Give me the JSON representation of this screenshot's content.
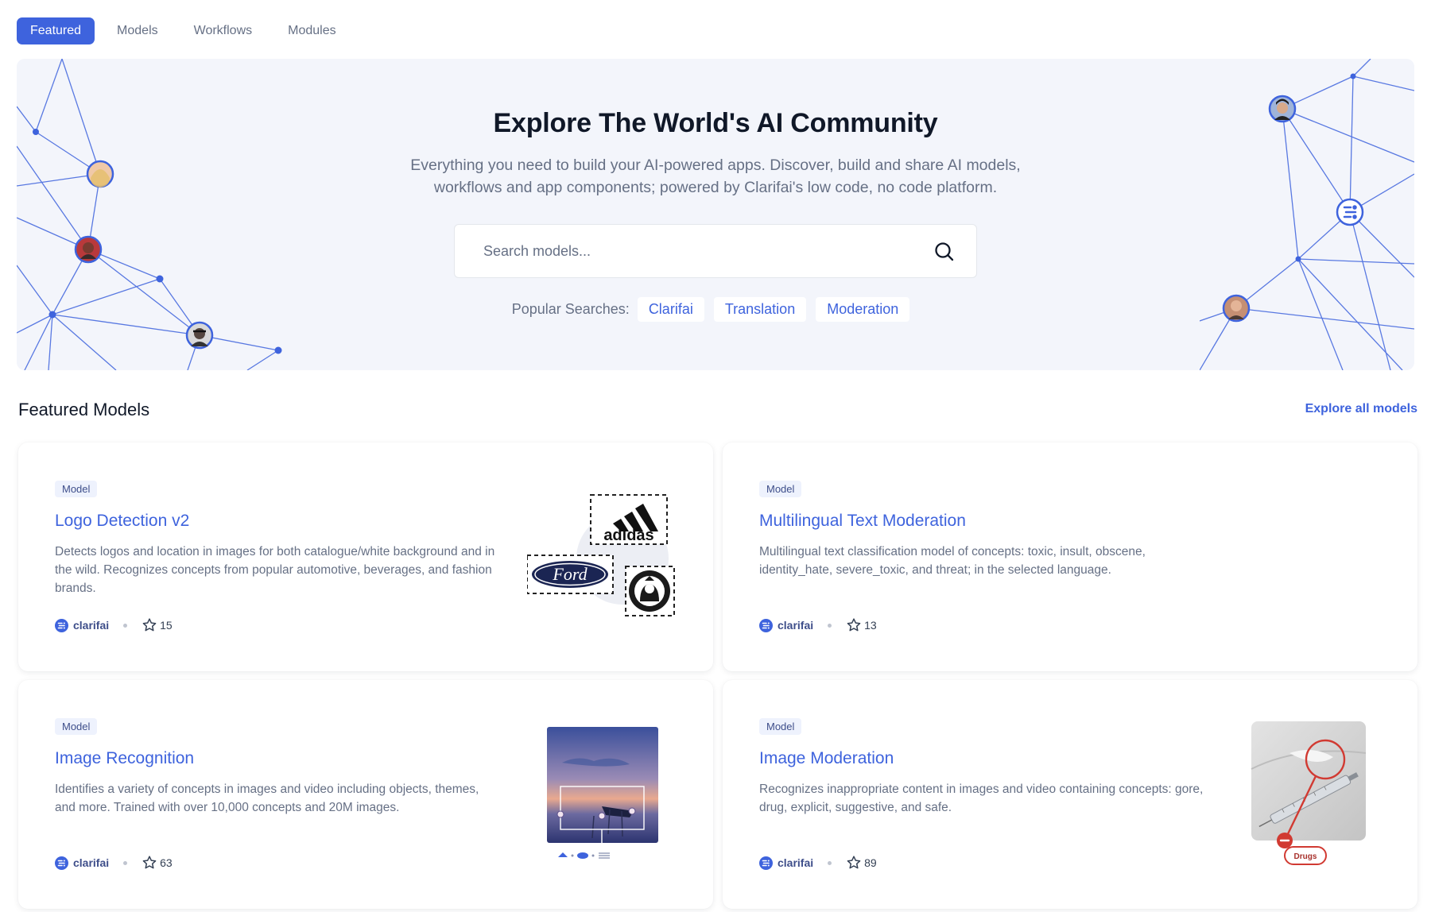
{
  "tabs": [
    {
      "label": "Featured",
      "active": true
    },
    {
      "label": "Models",
      "active": false
    },
    {
      "label": "Workflows",
      "active": false
    },
    {
      "label": "Modules",
      "active": false
    }
  ],
  "hero": {
    "title": "Explore The World's AI Community",
    "subtitle": "Everything you need to build your AI-powered apps. Discover, build and share AI models, workflows and app components; powered by Clarifai's low code, no code platform.",
    "search_placeholder": "Search models...",
    "popular_label": "Popular Searches:",
    "popular_searches": [
      "Clarifai",
      "Translation",
      "Moderation"
    ]
  },
  "featured": {
    "title": "Featured Models",
    "explore_link": "Explore all models",
    "cards": [
      {
        "badge": "Model",
        "title": "Logo Detection v2",
        "description": "Detects logos and location in images for both catalogue/white background and in the wild. Recognizes concepts from popular automotive, beverages, and fashion brands.",
        "owner": "clarifai",
        "stars": "15",
        "image_text": {
          "adidas": "adidas",
          "ford": "Ford"
        }
      },
      {
        "badge": "Model",
        "title": "Multilingual Text Moderation",
        "description": "Multilingual text classification model of concepts: toxic, insult, obscene, identity_hate, severe_toxic, and threat; in the selected language.",
        "owner": "clarifai",
        "stars": "13"
      },
      {
        "badge": "Model",
        "title": "Image Recognition",
        "description": "Identifies a variety of concepts in images and video including objects, themes, and more. Trained with over 10,000 concepts and 20M images.",
        "owner": "clarifai",
        "stars": "63"
      },
      {
        "badge": "Model",
        "title": "Image Moderation",
        "description": "Recognizes inappropriate content in images and video containing concepts: gore, drug, explicit, suggestive, and safe.",
        "owner": "clarifai",
        "stars": "89",
        "image_text": {
          "label": "Drugs"
        }
      }
    ]
  },
  "colors": {
    "accent": "#3e63dd",
    "hero_bg": "#f3f5fb",
    "muted_text": "#667085",
    "danger": "#d13a32"
  },
  "icons": [
    "search-icon",
    "clarifai-logo-icon",
    "star-icon"
  ]
}
